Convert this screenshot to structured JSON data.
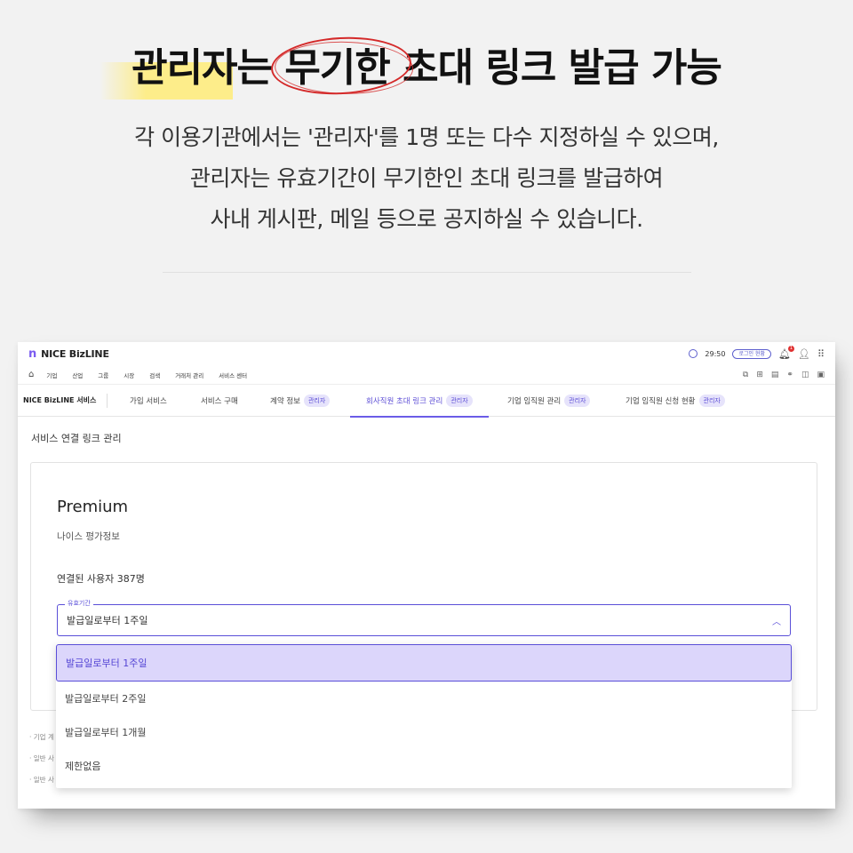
{
  "hero": {
    "title": "관리자는 무기한 초대 링크 발급 가능",
    "desc_lines": [
      "각 이용기관에서는 '관리자'를 1명 또는 다수 지정하실 수 있으며,",
      "관리자는 유효기간이 무기한인 초대 링크를 발급하여",
      "사내 게시판, 메일 등으로 공지하실 수 있습니다."
    ]
  },
  "app": {
    "logo_mark": "𝗻",
    "logo_text": "NICE BizLINE",
    "timer": "29:50",
    "login_status": "로그인 현황",
    "notification_count": "1",
    "menu": [
      "기업",
      "산업",
      "그룹",
      "시장",
      "검색",
      "거래처 관리",
      "서비스 센터"
    ],
    "service_label": "NICE BizLINE 서비스",
    "tabs": [
      {
        "label": "가입 서비스",
        "badge": ""
      },
      {
        "label": "서비스 구매",
        "badge": ""
      },
      {
        "label": "계약 정보",
        "badge": "관리자"
      },
      {
        "label": "회사직원 초대 링크 관리",
        "badge": "관리자"
      },
      {
        "label": "기업 임직원 관리",
        "badge": "관리자"
      },
      {
        "label": "기업 임직원 신청 현황",
        "badge": "관리자"
      }
    ],
    "section_title": "서비스 연결 링크 관리",
    "plan_name": "Premium",
    "provider": "나이스 평가정보",
    "connected_users": "연결된 사용자 387명",
    "validity": {
      "legend": "유효기간",
      "selected": "발급일로부터 1주일",
      "options": [
        "발급일로부터 1주일",
        "발급일로부터 2주일",
        "발급일로부터 1개월",
        "제한없음"
      ]
    },
    "footnotes": [
      "· 기업 계",
      "· 일반 사",
      "· 일반 사"
    ]
  },
  "colors": {
    "accent": "#5a4fd8",
    "highlight": "#ffec78",
    "circle": "#d42a2a"
  }
}
